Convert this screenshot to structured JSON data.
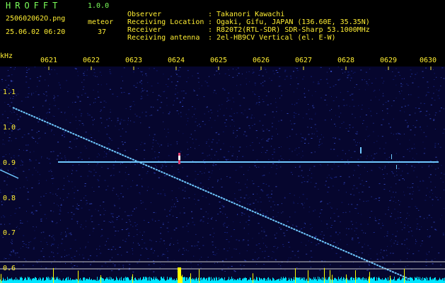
{
  "header": {
    "app_name": "HROFFT",
    "version": "1.0.0",
    "filename": "250602062O.png",
    "datetime": "25.06.02 06:20",
    "meteor_label": "meteor",
    "meteor_count": "37"
  },
  "info": [
    {
      "key": "Observer",
      "value": "Takanori Kawachi"
    },
    {
      "key": "Receiving Location",
      "value": "Ogaki, Gifu, JAPAN (136.60E, 35.35N)"
    },
    {
      "key": "Receiver",
      "value": "R820T2(RTL-SDR) SDR-Sharp 53.1000MHz"
    },
    {
      "key": "Receiving antenna",
      "value": "2el-HB9CV Vertical (el. E-W)"
    }
  ],
  "axis": {
    "y_unit": "kHz",
    "y_ticks": [
      "1.1",
      "1.0",
      "0.9",
      "0.8",
      "0.7",
      "0.6"
    ],
    "x_ticks": [
      "0621",
      "0622",
      "0623",
      "0624",
      "0625",
      "0626",
      "0627",
      "0628",
      "0629",
      "0630"
    ]
  },
  "colors": {
    "text_green": "#7cff5a",
    "text_yellow": "#ffee33",
    "background": "#06062e",
    "signal": "#6fc8ff",
    "power_trace": "#00e5ff",
    "peak": "#ffff00"
  }
}
